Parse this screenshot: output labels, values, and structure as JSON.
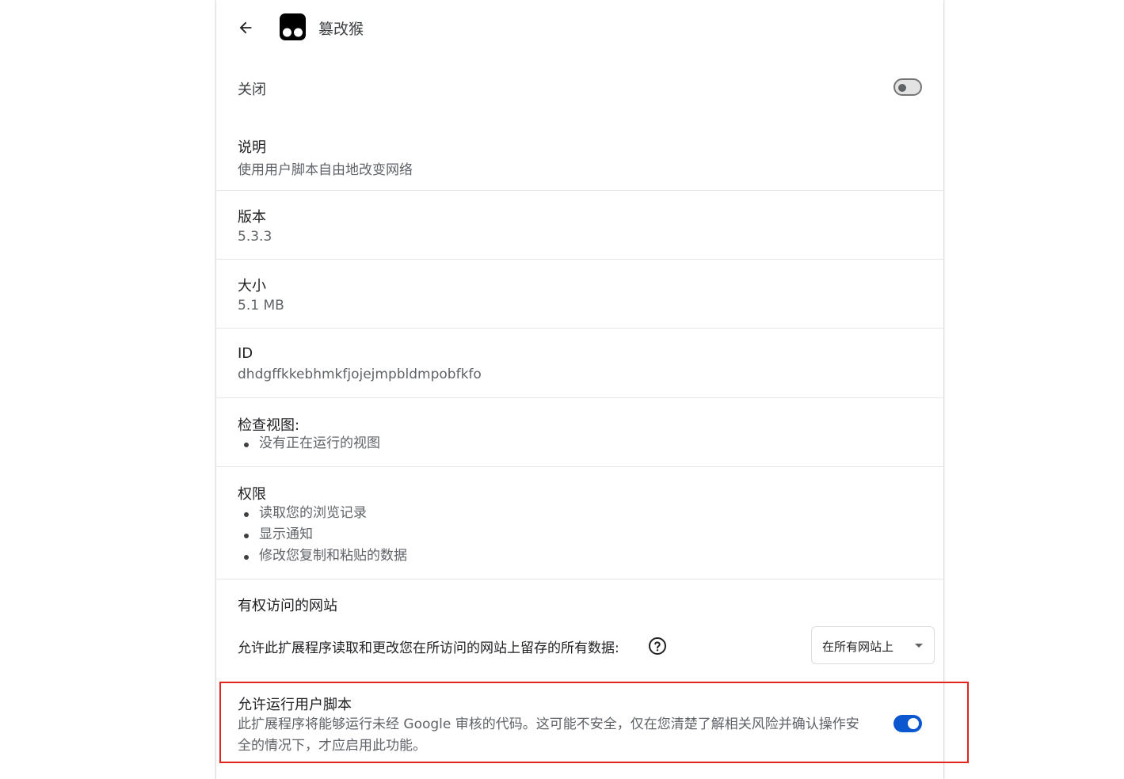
{
  "header": {
    "back_label": "",
    "icon_name": "tampermonkey-icon",
    "extension_name": "篡改猴"
  },
  "enable": {
    "label": "关闭",
    "state": "off"
  },
  "description": {
    "title": "说明",
    "value": "使用用户脚本自由地改变网络"
  },
  "version": {
    "title": "版本",
    "value": "5.3.3"
  },
  "size": {
    "title": "大小",
    "value": "5.1 MB"
  },
  "id": {
    "title": "ID",
    "value": "dhdgffkkebhmkfjojejmpbldmpobfkfo"
  },
  "inspect_views": {
    "title": "检查视图:",
    "items": [
      "没有正在运行的视图"
    ]
  },
  "permissions": {
    "title": "权限",
    "items": [
      "读取您的浏览记录",
      "显示通知",
      "修改您复制和粘贴的数据"
    ]
  },
  "site_access": {
    "title": "有权访问的网站",
    "text": "允许此扩展程序读取和更改您在所访问的网站上留存的所有数据:",
    "dropdown_value": "在所有网站上"
  },
  "user_scripts": {
    "title": "允许运行用户脚本",
    "description": "此扩展程序将能够运行未经 Google 审核的代码。这可能不安全，仅在您清楚了解相关风险并确认操作安全的情况下，才应启用此功能。",
    "state": "on"
  },
  "colors": {
    "accent": "#0b57d0",
    "highlight": "#e3231c"
  }
}
